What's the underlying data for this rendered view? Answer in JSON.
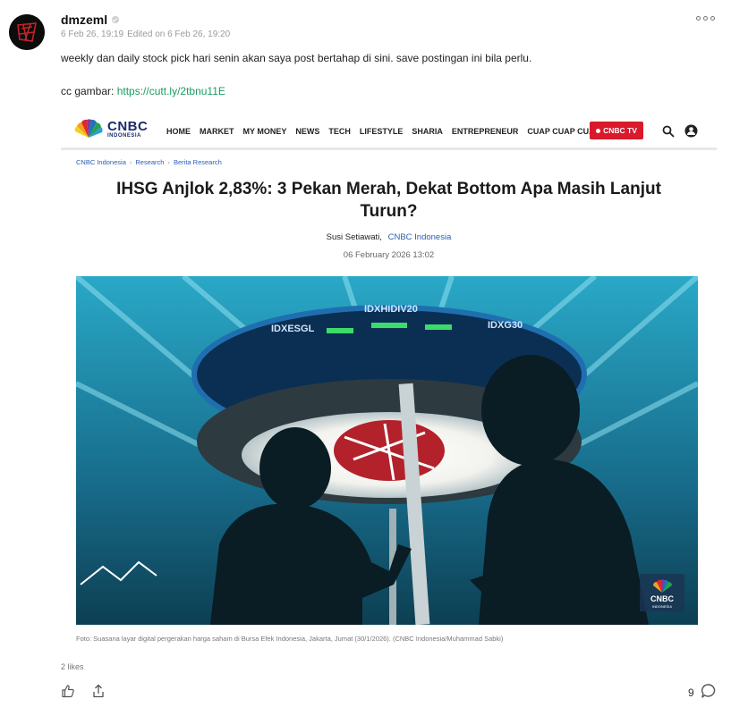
{
  "post": {
    "author": "dmzeml",
    "timestamp": "6 Feb 26, 19:19",
    "edited": "Edited on 6 Feb 26, 19:20",
    "text": "weekly dan daily stock pick hari senin akan saya post bertahap di sini. save postingan ini bila perlu.",
    "cc_label": "cc gambar:",
    "cc_link": "https://cutt.ly/2tbnu11E"
  },
  "embed": {
    "logo": {
      "main": "CNBC",
      "sub": "INDONESIA"
    },
    "menu": [
      "HOME",
      "MARKET",
      "MY MONEY",
      "NEWS",
      "TECH",
      "LIFESTYLE",
      "SHARIA",
      "ENTREPRENEUR",
      "CUAP CUAP CUAN"
    ],
    "tv_button": "CNBC TV",
    "breadcrumb": [
      "CNBC Indonesia",
      "Research",
      "Berita Research"
    ],
    "headline": "IHSG Anjlok 2,83%: 3 Pekan Merah, Dekat Bottom Apa Masih Lanjut Turun?",
    "author": "Susi Setiawati,",
    "source": "CNBC Indonesia",
    "date": "06 February 2026 13:02",
    "ticker": [
      "IDXHIDIV20",
      "IDXESGL",
      "IDXG30"
    ],
    "watermark": {
      "main": "CNBC",
      "sub": "INDONESIA"
    },
    "caption": "Foto: Suasana layar digital pergerakan harga saham di Bursa Efek Indonesia, Jakarta, Jumat (30/1/2026). (CNBC Indonesia/Muhammad Sabki)"
  },
  "footer": {
    "likes": "2 likes",
    "comments": "9"
  },
  "colors": {
    "link_green": "#1a9b62",
    "cnbc_navy": "#1b2a6b",
    "tv_red": "#d9192c"
  },
  "icons": [
    "verified-icon",
    "more-options-icon",
    "search-icon",
    "user-icon",
    "thumbs-up-icon",
    "share-icon",
    "comment-icon"
  ]
}
